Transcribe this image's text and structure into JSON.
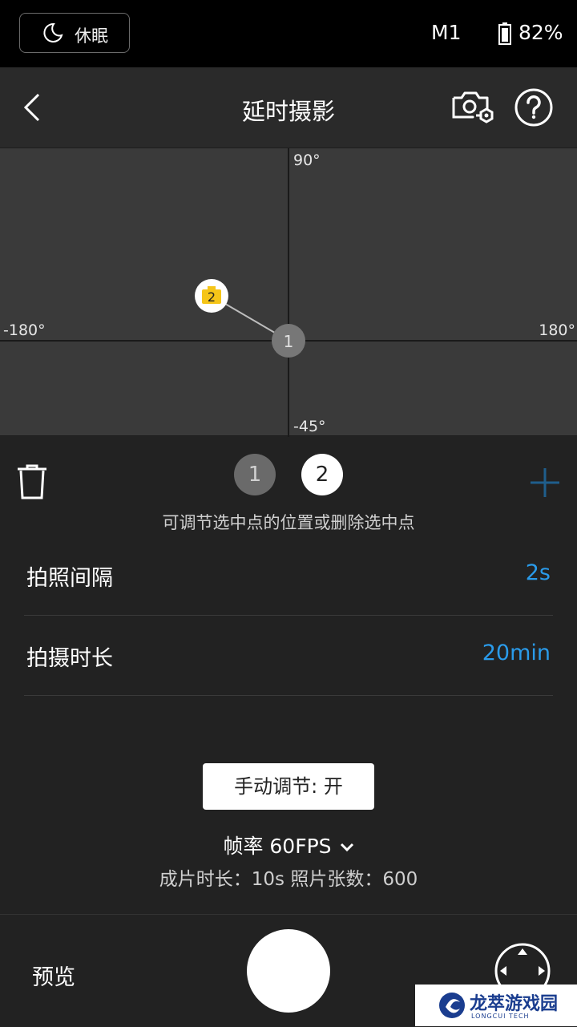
{
  "status_bar": {
    "sleep_label": "休眠",
    "mode": "M1",
    "battery": "82%"
  },
  "nav": {
    "title": "延时摄影",
    "icons": [
      "back-icon",
      "camera-settings-icon",
      "help-icon"
    ]
  },
  "canvas": {
    "labels": {
      "top": "90°",
      "bottom": "-45°",
      "left": "-180°",
      "right": "180°"
    },
    "points": [
      {
        "label": "1",
        "pan_deg": 0,
        "tilt_deg": 0,
        "selected": false
      },
      {
        "label": "2",
        "pan_deg": -48,
        "tilt_deg": 21,
        "selected": true
      }
    ],
    "colors": {
      "selected_point": "#F5C518",
      "point": "#777777"
    }
  },
  "point_selector": {
    "points": [
      "1",
      "2"
    ],
    "selected": "2"
  },
  "hint": "可调节选中点的位置或删除选中点",
  "settings": [
    {
      "label": "拍照间隔",
      "value": "2s"
    },
    {
      "label": "拍摄时长",
      "value": "20min"
    }
  ],
  "manual_button": "手动调节: 开",
  "fps_select": "帧率 60FPS",
  "clip_info": "成片时长：10s   照片张数：600",
  "bottom_bar": {
    "preview_label": "预览"
  },
  "watermark": {
    "text": "龙萃游戏园",
    "sub": "LONGCUI TECH"
  },
  "colors": {
    "accent": "#2A9BEA",
    "background": "#222222",
    "canvas": "#3A3A3A"
  }
}
